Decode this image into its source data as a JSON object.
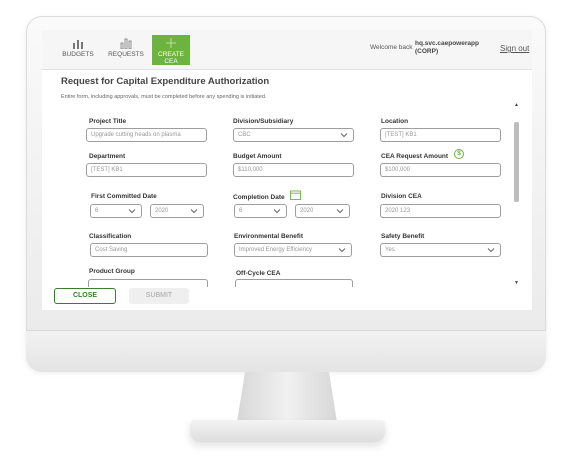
{
  "nav": {
    "budgets": "BUDGETS",
    "requests": "REQUESTS",
    "create": "CREATE CEA",
    "welcome": "Welcome back",
    "user_line1": "hq.svc.caepowerapp",
    "user_line2": "(CORP)",
    "signout": "Sign out"
  },
  "form": {
    "title": "Request for Capital Expenditure Authorization",
    "subtitle": "Entire form, including approvals, must be completed before any spending is initiated.",
    "project_title": {
      "label": "Project Title",
      "value": "Upgrade cutting heads on plasma"
    },
    "division": {
      "label": "Division/Subsidiary",
      "value": "CBC"
    },
    "location": {
      "label": "Location",
      "value": "[TEST] KB1"
    },
    "department": {
      "label": "Department",
      "value": "[TEST] KB1"
    },
    "budget_amount": {
      "label": "Budget Amount",
      "value": "$110,000"
    },
    "cea_request": {
      "label": "CEA Request Amount",
      "value": "$100,000"
    },
    "first_committed": {
      "label": "First Committed Date",
      "month": "6",
      "year": "2020"
    },
    "completion": {
      "label": "Completion Date",
      "month": "6",
      "year": "2020"
    },
    "division_cea": {
      "label": "Division CEA",
      "value": "2020 123"
    },
    "classification": {
      "label": "Classification",
      "value": "Cost Saving"
    },
    "environmental": {
      "label": "Environmental Benefit",
      "value": "Improved Energy Efficiency"
    },
    "safety": {
      "label": "Safety Benefit",
      "value": "Yes"
    },
    "product_group": {
      "label": "Product Group",
      "value": ""
    },
    "off_cycle": {
      "label": "Off-Cycle CEA",
      "value": ""
    }
  },
  "buttons": {
    "close": "CLOSE",
    "submit": "SUBMIT"
  },
  "colors": {
    "accent": "#6db33f",
    "close_border": "#3a7d2a"
  }
}
